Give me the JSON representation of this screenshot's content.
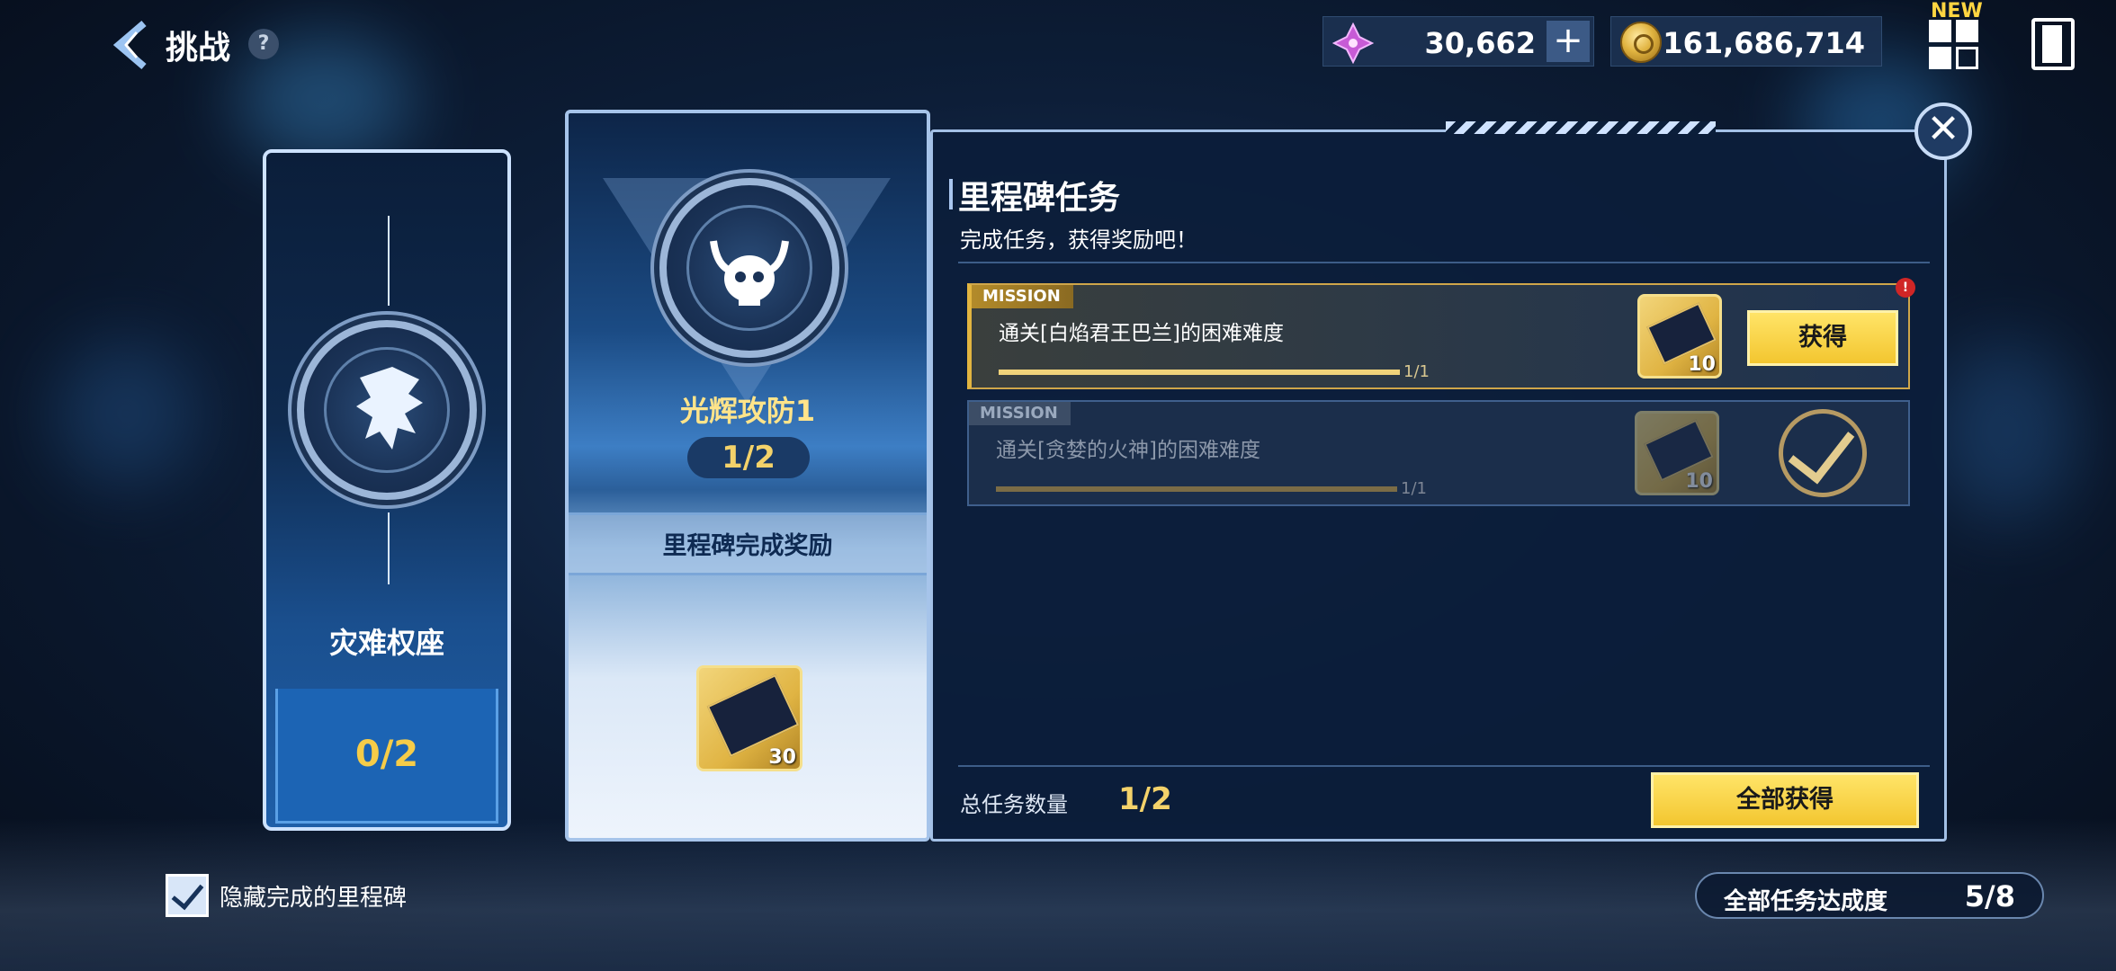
{
  "header": {
    "title": "挑战",
    "help_icon": "?",
    "gem_amount": "30,662",
    "plus_label": "+",
    "gold_amount": "161,686,714",
    "new_badge": "NEW"
  },
  "left_card": {
    "name": "灾难权座",
    "count": "0/2"
  },
  "middle_card": {
    "name": "光辉攻防1",
    "count": "1/2",
    "reward_label": "里程碑完成奖励",
    "reward_quantity": "30"
  },
  "panel": {
    "title": "里程碑任务",
    "subtitle": "完成任务，获得奖励吧！",
    "close_label": "✕",
    "missions": [
      {
        "tag": "MISSION",
        "text": "通关[白焰君王巴兰]的困难难度",
        "progress": "1/1",
        "progress_fraction": 1.0,
        "reward_quantity": "10",
        "action_label": "获得",
        "alert": "!",
        "status": "claimable"
      },
      {
        "tag": "MISSION",
        "text": "通关[贪婪的火神]的困难难度",
        "progress": "1/1",
        "progress_fraction": 1.0,
        "reward_quantity": "10",
        "status": "completed"
      }
    ],
    "total_label": "总任务数量",
    "total_count": "1/2",
    "claim_all_label": "全部获得"
  },
  "footer": {
    "hide_completed_label": "隐藏完成的里程碑",
    "hide_completed_checked": true,
    "overall_label": "全部任务达成度",
    "overall_value": "5/8"
  },
  "colors": {
    "accent_gold": "#f3c630",
    "count_gold": "#f4d26a",
    "panel_bg": "#0c1e3a",
    "alert_red": "#d02626"
  }
}
